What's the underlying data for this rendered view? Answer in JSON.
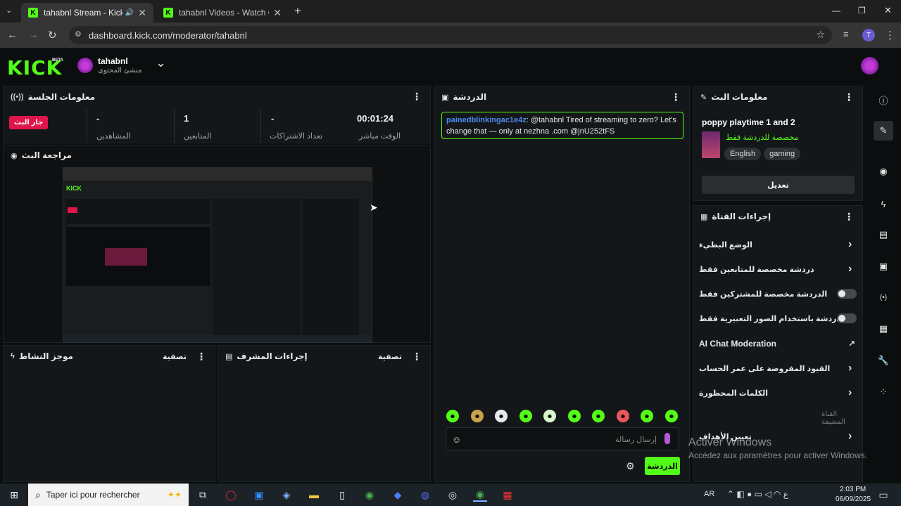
{
  "browser": {
    "tabs": [
      {
        "title": "tahabnl Stream - Kick Dashl",
        "audio_icon": "🔊",
        "close": "✕"
      },
      {
        "title": "tahabnl Videos - Watch On-Der",
        "close": "✕"
      }
    ],
    "new_tab": "+",
    "url": "dashboard.kick.com/moderator/tahabnl",
    "profile_initial": "T",
    "window_controls": {
      "minimize": "—",
      "restore": "❐",
      "close": "✕"
    }
  },
  "header": {
    "logo": "KICK",
    "beta": "BETA",
    "channel_name": "tahabnl",
    "channel_role": "منشئ المحتوى",
    "dropdown": "⌄"
  },
  "session": {
    "title": "معلومات الجلسة",
    "live_badge": "جار البث",
    "stats": [
      {
        "value": "00:01:24",
        "label": "الوقت مباشر"
      },
      {
        "value": "-",
        "label": "تعداد الاشتراكات"
      },
      {
        "value": "1",
        "label": "المتابعين"
      },
      {
        "value": "-",
        "label": "المشاهدين"
      }
    ]
  },
  "preview": {
    "title": "مراجعة البث"
  },
  "activity": {
    "title": "موجز النشاط",
    "filter": "تصفية"
  },
  "mod_actions": {
    "title": "إجراءات المشرف",
    "filter": "تصفية"
  },
  "chat": {
    "title": "الدردشة",
    "message": {
      "user": "painedblinkingac1e4z",
      "text": ": @tahabnl Tired of streaming to zero? Let's change that — only at nezhna .com @jnU252tFS"
    },
    "input_placeholder": "إرسال رسالة",
    "send": "الدردشة",
    "emotes": [
      "☻",
      "☻",
      "☻",
      "☻",
      "☻",
      "☻",
      "☻",
      "☻",
      "☻",
      "☻"
    ]
  },
  "stream_info": {
    "title": "معلومات البث",
    "stream_title": "poppy playtime 1 and 2",
    "category_note": "مخصصة للدردشة فقط",
    "tags": [
      "English",
      "gaming"
    ],
    "edit_button": "تعديل"
  },
  "channel_actions": {
    "title": "إجراءات القناة",
    "items": [
      {
        "label": "الوضع البطيء",
        "control": "chevron"
      },
      {
        "label": "دردشة مخصصة للمتابعين فقط",
        "control": "chevron"
      },
      {
        "label": "الدردشة مخصصة للمشتركين فقط",
        "control": "toggle"
      },
      {
        "label": "الدردشة باستخدام الصور التعبيرية فقط",
        "control": "toggle"
      },
      {
        "label": "AI Chat Moderation",
        "control": "external"
      },
      {
        "label": "القيود المفروضة على عمر الحساب",
        "control": "chevron"
      },
      {
        "label": "الكلمات المحظورة",
        "control": "chevron"
      }
    ],
    "host_label": "القناة المضيفة",
    "goals": "تعيين الأهداف"
  },
  "watermark": {
    "line1": "Activer Windows",
    "line2": "Accédez aux paramètres pour activer Windows."
  },
  "taskbar": {
    "search_placeholder": "Taper ici pour rechercher",
    "lang": "AR",
    "time": "2:03 PM",
    "date": "06/09/2025"
  },
  "colors": {
    "accent": "#53fc18",
    "panel": "#141719",
    "bg": "#0b0e0f",
    "live": "#e0154a"
  }
}
